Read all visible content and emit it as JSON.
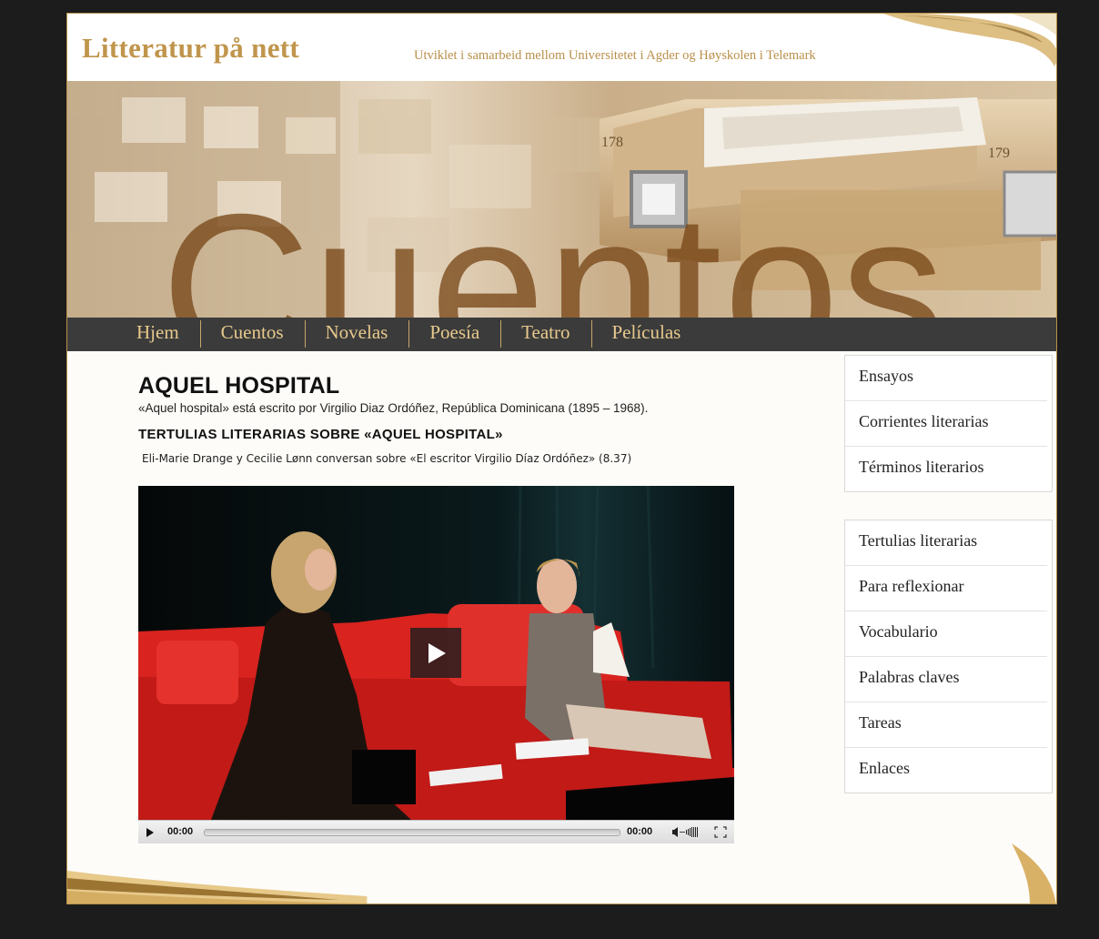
{
  "header": {
    "site_title": "Litteratur på nett",
    "tagline": "Utviklet i samarbeid mellom Universitetet i Agder og Høyskolen i Telemark"
  },
  "banner": {
    "word": "Cuentos",
    "drawer_numbers": [
      "178",
      "179"
    ]
  },
  "nav": {
    "items": [
      "Hjem",
      "Cuentos",
      "Novelas",
      "Poesía",
      "Teatro",
      "Películas"
    ]
  },
  "main": {
    "title": "AQUEL HOSPITAL",
    "intro": "«Aquel hospital» está escrito por Virgilio Diaz Ordóñez, República Dominicana (1895 – 1968).",
    "section_heading": "TERTULIAS LITERARIAS SOBRE «AQUEL HOSPITAL»",
    "video_caption": "Eli-Marie Drange y Cecilie Lønn conversan sobre «El escritor Virgilio Díaz Ordóñez» (8.37)"
  },
  "video": {
    "current_time": "00:00",
    "duration": "00:00",
    "progress": 0
  },
  "sidebar": {
    "box1": [
      "Ensayos",
      "Corrientes literarias",
      "Términos literarios"
    ],
    "box2": [
      "Tertulias literarias",
      "Para reflexionar",
      "Vocabulario",
      "Palabras claves",
      "Tareas",
      "Enlaces"
    ]
  },
  "colors": {
    "gold": "#c0954c",
    "nav_bg": "#3b3b3b",
    "nav_text": "#e8c98c",
    "page_bg": "#1c1c1c",
    "sofa_red": "#d8231f"
  }
}
